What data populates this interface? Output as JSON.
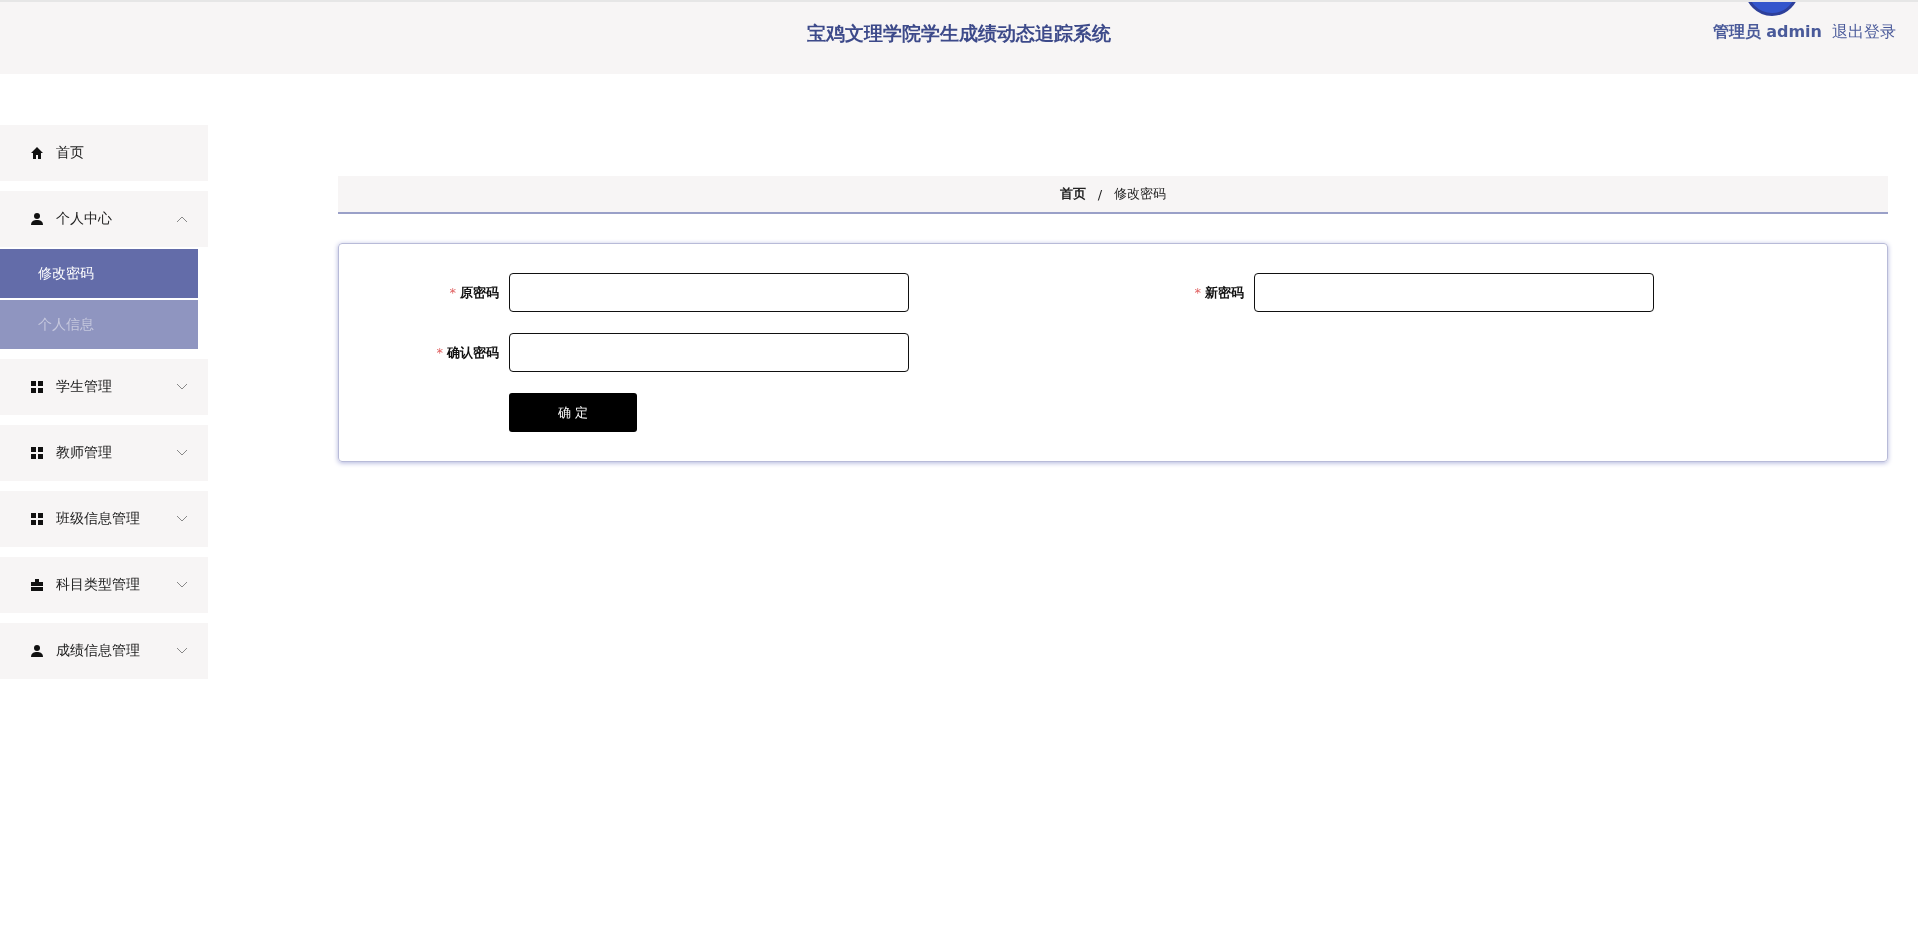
{
  "header": {
    "title": "宝鸡文理学院学生成绩动态追踪系统",
    "user": "管理员 admin",
    "logout": "退出登录"
  },
  "sidebar": {
    "items": [
      {
        "label": "首页"
      },
      {
        "label": "个人中心",
        "expanded": true,
        "children": [
          {
            "label": "修改密码",
            "selected": true
          },
          {
            "label": "个人信息",
            "selected": false
          }
        ]
      },
      {
        "label": "学生管理",
        "expanded": false
      },
      {
        "label": "教师管理",
        "expanded": false
      },
      {
        "label": "班级信息管理",
        "expanded": false
      },
      {
        "label": "科目类型管理",
        "expanded": false
      },
      {
        "label": "成绩信息管理",
        "expanded": false
      }
    ]
  },
  "breadcrumb": [
    "首页",
    "/",
    "修改密码"
  ],
  "form": {
    "fields": [
      {
        "label": "原密码",
        "mark": "*"
      },
      {
        "label": "新密码",
        "mark": "*"
      },
      {
        "label": "确认密码",
        "mark": "*"
      }
    ],
    "submit": "确 定"
  }
}
